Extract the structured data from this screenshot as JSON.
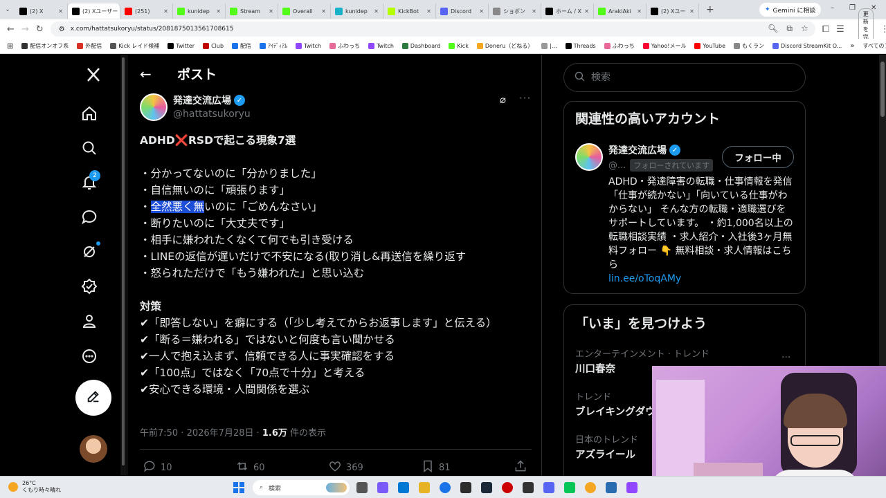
{
  "browser": {
    "tabs": [
      {
        "label": "(2) X",
        "color": "#000000",
        "active": false
      },
      {
        "label": "(2) Xユーザー",
        "color": "#000000",
        "active": true
      },
      {
        "label": "(251)",
        "color": "#ff0000",
        "active": false
      },
      {
        "label": "kunidep",
        "color": "#53fc18",
        "active": false
      },
      {
        "label": "Stream",
        "color": "#53fc18",
        "active": false
      },
      {
        "label": "Overall",
        "color": "#53fc18",
        "active": false
      },
      {
        "label": "kunidep",
        "color": "#1ab0c8",
        "active": false
      },
      {
        "label": "KickBot",
        "color": "#b6ff00",
        "active": false
      },
      {
        "label": "Discord",
        "color": "#5865f2",
        "active": false
      },
      {
        "label": "ショボン",
        "color": "#888888",
        "active": false
      },
      {
        "label": "ホーム / X",
        "color": "#000000",
        "active": false
      },
      {
        "label": "ArakiAki",
        "color": "#53fc18",
        "active": false
      },
      {
        "label": "(2) Xユー",
        "color": "#000000",
        "active": false
      }
    ],
    "new_tab": "+",
    "gemini_label": "Gemini に相談",
    "url": "x.com/hattatsukoryu/status/2081875013561708615",
    "update_label": "更新を完了",
    "bookmarks": [
      {
        "label": "配信オンオフ系",
        "color": "#333333"
      },
      {
        "label": "外配信",
        "color": "#d93025"
      },
      {
        "label": "Kick レイド候補",
        "color": "#555555"
      },
      {
        "label": "Twitter",
        "color": "#000000"
      },
      {
        "label": "Club",
        "color": "#c00000"
      },
      {
        "label": "配信",
        "color": "#1a73e8"
      },
      {
        "label": "ｱｲﾃﾞｨｱﾑ",
        "color": "#1a73e8"
      },
      {
        "label": "Twitch",
        "color": "#9146ff"
      },
      {
        "label": "ふわっち",
        "color": "#e86a9a"
      },
      {
        "label": "Twitch",
        "color": "#9146ff"
      },
      {
        "label": "Dashboard",
        "color": "#2b7a3f"
      },
      {
        "label": "Kick",
        "color": "#53fc18"
      },
      {
        "label": "Doneru（どねる）",
        "color": "#f5a623"
      },
      {
        "label": "|...",
        "color": "#999999"
      },
      {
        "label": "Threads",
        "color": "#000000"
      },
      {
        "label": "ふわっち",
        "color": "#e86a9a"
      },
      {
        "label": "Yahoo!メール",
        "color": "#ff0033"
      },
      {
        "label": "YouTube",
        "color": "#ff0000"
      },
      {
        "label": "もくラン",
        "color": "#888888"
      },
      {
        "label": "Discord StreamKit O...",
        "color": "#5865f2"
      }
    ],
    "all_bookmarks": "すべてのブックマーク"
  },
  "nav": {
    "notifications_badge": "2"
  },
  "header": {
    "title": "ポスト"
  },
  "post": {
    "author_name": "発達交流広場",
    "author_handle": "@hattatsukoryu",
    "line1": "ADHD❌RSDで起こる現象7選",
    "line2": "",
    "line3": "・分かってないのに「分かりました」",
    "line4": "・自信無いのに「頑張ります」",
    "line5_pre": "・",
    "line5_sel": "全然悪く無",
    "line5_post": "いのに「ごめんなさい」",
    "line6": "・断りたいのに「大丈夫です」",
    "line7": "・相手に嫌われたくなくて何でも引き受ける",
    "line8": "・LINEの返信が遅いだけで不安になる(取り消し&再送信を繰り返す",
    "line9": "・怒られただけで「もう嫌われた」と思い込む",
    "line10": "",
    "line11": "対策",
    "line12": "✔「即答しない」を癖にする（「少し考えてからお返事します」と伝える）",
    "line13": "✔「断る＝嫌われる」ではないと何度も言い聞かせる",
    "line14": "✔一人で抱え込まず、信頼できる人に事実確認をする",
    "line15": "✔「100点」ではなく「70点で十分」と考える",
    "line16": "✔安心できる環境・人間関係を選ぶ",
    "time": "午前7:50 · 2026年7月28日 · ",
    "views_count": "1.6万",
    "views_label": " 件の表示",
    "replies": "10",
    "reposts": "60",
    "likes": "369",
    "bookmarks": "81"
  },
  "sidebar": {
    "search_placeholder": "検索",
    "related_title": "関連性の高いアカウント",
    "account_name": "発達交流広場",
    "account_handle": "@...",
    "follows_you": "フォローされています",
    "follow_button": "フォロー中",
    "bio": "ADHD・発達障害の転職・仕事情報を発信「仕事が続かない」「向いている仕事がわからない」 そんな方の転職・適職選びをサポートしています。 ・約1,000名以上の転職相談実績 ・求人紹介・入社後3ヶ月無料フォロー 👇 無料相談・求人情報はこちら",
    "bio_link": "lin.ee/oToqAMy",
    "trends_title": "「いま」を見つけよう",
    "trends": [
      {
        "context": "エンターテインメント · トレンド",
        "title": "川口春奈"
      },
      {
        "context": "トレンド",
        "title": "ブレイキングダウ"
      },
      {
        "context": "日本のトレンド",
        "title": "アズライール"
      }
    ]
  },
  "taskbar": {
    "temp": "26°C",
    "weather": "くもり時々晴れ",
    "search_label": "検索"
  }
}
